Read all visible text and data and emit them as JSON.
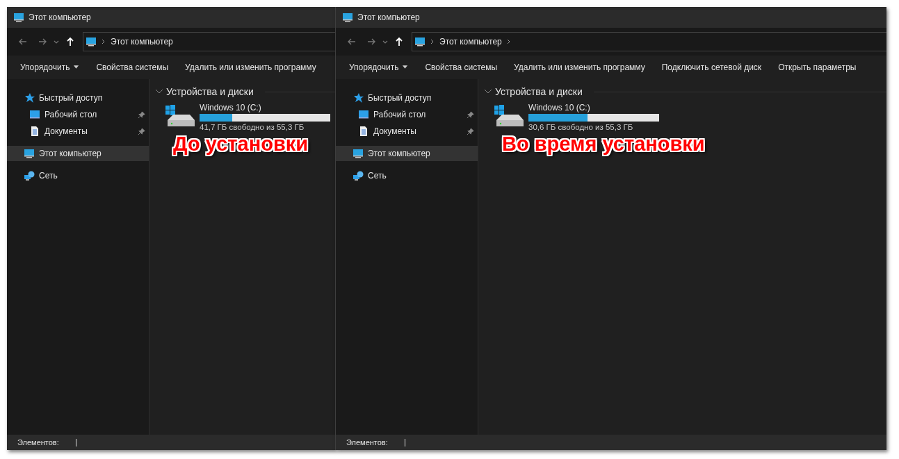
{
  "windows": [
    {
      "title": "Этот компьютер",
      "address": {
        "location": "Этот компьютер",
        "chevron_after": false
      },
      "toolbar": [
        {
          "label": "Упорядочить",
          "dropdown": true
        },
        {
          "label": "Свойства системы",
          "dropdown": false
        },
        {
          "label": "Удалить или изменить программу",
          "dropdown": false
        }
      ],
      "sidebar": [
        {
          "kind": "star",
          "label": "Быстрый доступ",
          "pinned": false,
          "selected": false,
          "children": [
            {
              "kind": "desktop",
              "label": "Рабочий стол",
              "pinned": true,
              "selected": false
            },
            {
              "kind": "document",
              "label": "Документы",
              "pinned": true,
              "selected": false
            }
          ]
        },
        {
          "kind": "pc",
          "label": "Этот компьютер",
          "pinned": false,
          "selected": true
        },
        {
          "kind": "network",
          "label": "Сеть",
          "pinned": false,
          "selected": false
        }
      ],
      "section": "Устройства и диски",
      "drive": {
        "name": "Windows 10 (C:)",
        "level": 0.25,
        "free": "41,7 ГБ свободно из 55,3 ГБ"
      },
      "annotation": "До установки",
      "status": "Элементов:"
    },
    {
      "title": "Этот компьютер",
      "address": {
        "location": "Этот компьютер",
        "chevron_after": true
      },
      "toolbar": [
        {
          "label": "Упорядочить",
          "dropdown": true
        },
        {
          "label": "Свойства системы",
          "dropdown": false
        },
        {
          "label": "Удалить или изменить программу",
          "dropdown": false
        },
        {
          "label": "Подключить сетевой диск",
          "dropdown": false
        },
        {
          "label": "Открыть параметры",
          "dropdown": false
        }
      ],
      "sidebar": [
        {
          "kind": "star",
          "label": "Быстрый доступ",
          "pinned": false,
          "selected": false,
          "children": [
            {
              "kind": "desktop",
              "label": "Рабочий стол",
              "pinned": true,
              "selected": false
            },
            {
              "kind": "document",
              "label": "Документы",
              "pinned": true,
              "selected": false
            }
          ]
        },
        {
          "kind": "pc",
          "label": "Этот компьютер",
          "pinned": false,
          "selected": true
        },
        {
          "kind": "network",
          "label": "Сеть",
          "pinned": false,
          "selected": false
        }
      ],
      "section": "Устройства и диски",
      "drive": {
        "name": "Windows 10 (C:)",
        "level": 0.45,
        "free": "30,6 ГБ свободно из 55,3 ГБ"
      },
      "annotation": "Во время установки",
      "status": "Элементов:"
    }
  ]
}
